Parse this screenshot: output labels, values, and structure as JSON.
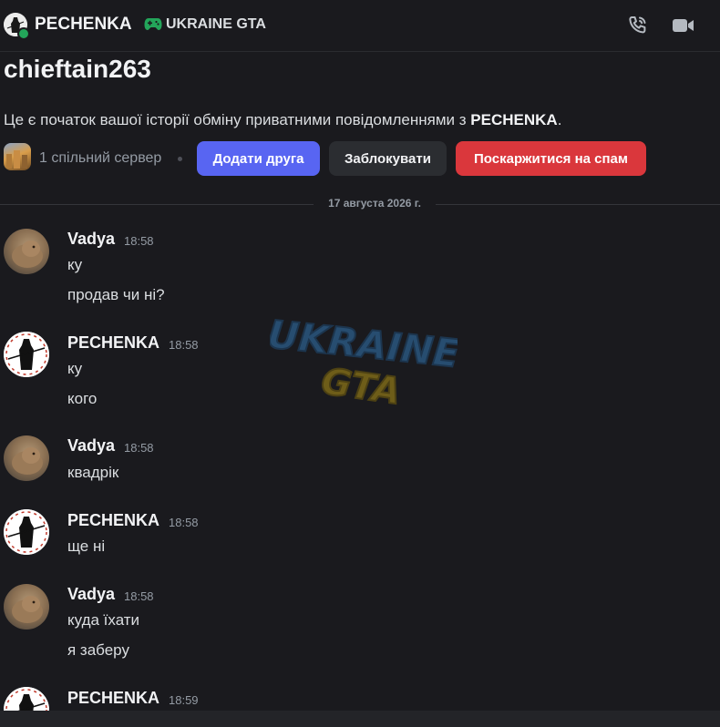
{
  "header": {
    "user_name": "PECHENKA",
    "server_name": "UKRAINE GTA",
    "icons": [
      "gamepad-icon",
      "phone-call-icon",
      "video-camera-icon"
    ]
  },
  "intro": {
    "title": "chieftain263",
    "text_prefix": "Це є початок вашої історії обміну приватними повідомленнями з ",
    "text_name": "PECHENKA",
    "text_suffix": ".",
    "mutual_servers": "1 спільний сервер",
    "buttons": {
      "add_friend": "Додати друга",
      "block": "Заблокувати",
      "report_spam": "Поскаржитися на спам"
    }
  },
  "date_divider": "17 августа 2026 г.",
  "watermark": {
    "line1": "UKRAINE",
    "line2": "GTA"
  },
  "messages": [
    {
      "user": "Vadya",
      "time": "18:58",
      "lines": [
        "ку",
        "продав чи ні?"
      ]
    },
    {
      "user": "PECHENKA",
      "time": "18:58",
      "lines": [
        "ку",
        "кого"
      ]
    },
    {
      "user": "Vadya",
      "time": "18:58",
      "lines": [
        "квадрік"
      ]
    },
    {
      "user": "PECHENKA",
      "time": "18:58",
      "lines": [
        "ще ні"
      ]
    },
    {
      "user": "Vadya",
      "time": "18:58",
      "lines": [
        "куда їхати",
        "я заберу"
      ]
    },
    {
      "user": "PECHENKA",
      "time": "18:59",
      "lines": []
    }
  ],
  "colors": {
    "background": "#1a1a1e",
    "blurple": "#5865f2",
    "danger": "#da373c",
    "online": "#23a55a",
    "gamepad": "#23a55a"
  }
}
